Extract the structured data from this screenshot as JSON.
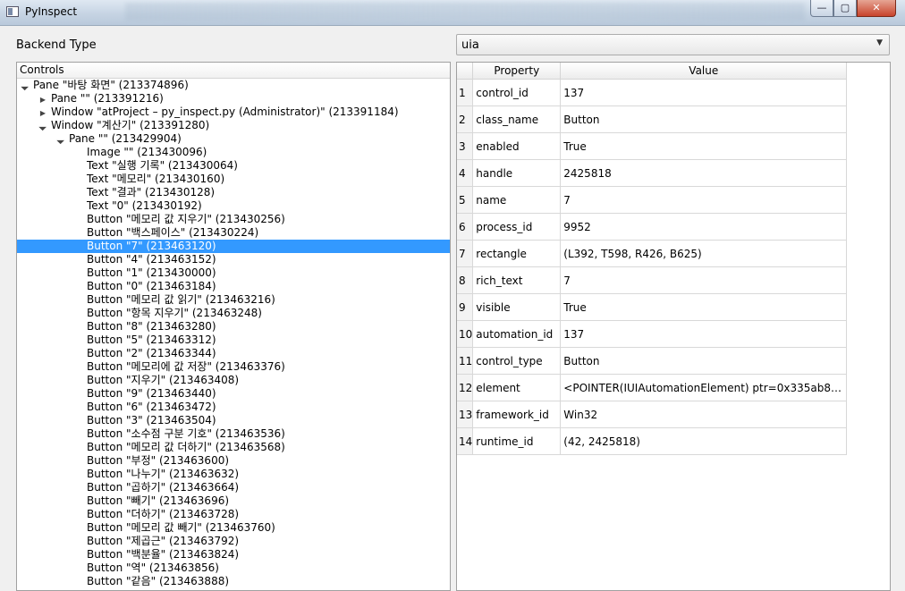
{
  "window": {
    "title": "PyInspect",
    "minimize": "—",
    "maximize": "▢",
    "close": "✕"
  },
  "backend": {
    "label": "Backend Type",
    "value": "uia"
  },
  "tree": {
    "header": "Controls",
    "rows": [
      {
        "level": 0,
        "arrow": "down",
        "text": "Pane \"바탕 화면\" (213374896)"
      },
      {
        "level": 1,
        "arrow": "right",
        "text": "Pane \"\" (213391216)"
      },
      {
        "level": 1,
        "arrow": "right",
        "text": "Window \"atProject – py_inspect.py (Administrator)\" (213391184)"
      },
      {
        "level": 1,
        "arrow": "down",
        "text": "Window \"계산기\" (213391280)"
      },
      {
        "level": 2,
        "arrow": "down",
        "text": "Pane \"\" (213429904)"
      },
      {
        "level": 3,
        "arrow": "none",
        "text": "Image \"\" (213430096)"
      },
      {
        "level": 3,
        "arrow": "none",
        "text": "Text \"실행 기록\" (213430064)"
      },
      {
        "level": 3,
        "arrow": "none",
        "text": "Text \"메모리\" (213430160)"
      },
      {
        "level": 3,
        "arrow": "none",
        "text": "Text \"결과\" (213430128)"
      },
      {
        "level": 3,
        "arrow": "none",
        "text": "Text \"0\" (213430192)"
      },
      {
        "level": 3,
        "arrow": "none",
        "text": "Button \"메모리 값 지우기\" (213430256)"
      },
      {
        "level": 3,
        "arrow": "none",
        "text": "Button \"백스페이스\" (213430224)"
      },
      {
        "level": 3,
        "arrow": "none",
        "text": "Button \"7\" (213463120)",
        "selected": true
      },
      {
        "level": 3,
        "arrow": "none",
        "text": "Button \"4\" (213463152)"
      },
      {
        "level": 3,
        "arrow": "none",
        "text": "Button \"1\" (213430000)"
      },
      {
        "level": 3,
        "arrow": "none",
        "text": "Button \"0\" (213463184)"
      },
      {
        "level": 3,
        "arrow": "none",
        "text": "Button \"메모리 값 읽기\" (213463216)"
      },
      {
        "level": 3,
        "arrow": "none",
        "text": "Button \"항목 지우기\" (213463248)"
      },
      {
        "level": 3,
        "arrow": "none",
        "text": "Button \"8\" (213463280)"
      },
      {
        "level": 3,
        "arrow": "none",
        "text": "Button \"5\" (213463312)"
      },
      {
        "level": 3,
        "arrow": "none",
        "text": "Button \"2\" (213463344)"
      },
      {
        "level": 3,
        "arrow": "none",
        "text": "Button \"메모리에 값 저장\" (213463376)"
      },
      {
        "level": 3,
        "arrow": "none",
        "text": "Button \"지우기\" (213463408)"
      },
      {
        "level": 3,
        "arrow": "none",
        "text": "Button \"9\" (213463440)"
      },
      {
        "level": 3,
        "arrow": "none",
        "text": "Button \"6\" (213463472)"
      },
      {
        "level": 3,
        "arrow": "none",
        "text": "Button \"3\" (213463504)"
      },
      {
        "level": 3,
        "arrow": "none",
        "text": "Button \"소수점 구분 기호\" (213463536)"
      },
      {
        "level": 3,
        "arrow": "none",
        "text": "Button \"메모리 값 더하기\" (213463568)"
      },
      {
        "level": 3,
        "arrow": "none",
        "text": "Button \"부정\" (213463600)"
      },
      {
        "level": 3,
        "arrow": "none",
        "text": "Button \"나누기\" (213463632)"
      },
      {
        "level": 3,
        "arrow": "none",
        "text": "Button \"곱하기\" (213463664)"
      },
      {
        "level": 3,
        "arrow": "none",
        "text": "Button \"빼기\" (213463696)"
      },
      {
        "level": 3,
        "arrow": "none",
        "text": "Button \"더하기\" (213463728)"
      },
      {
        "level": 3,
        "arrow": "none",
        "text": "Button \"메모리 값 빼기\" (213463760)"
      },
      {
        "level": 3,
        "arrow": "none",
        "text": "Button \"제곱근\" (213463792)"
      },
      {
        "level": 3,
        "arrow": "none",
        "text": "Button \"백분율\" (213463824)"
      },
      {
        "level": 3,
        "arrow": "none",
        "text": "Button \"역\" (213463856)"
      },
      {
        "level": 3,
        "arrow": "none",
        "text": "Button \"같음\" (213463888)"
      }
    ]
  },
  "properties": {
    "columns": [
      "Property",
      "Value"
    ],
    "rows": [
      {
        "num": "1",
        "name": "control_id",
        "value": "137"
      },
      {
        "num": "2",
        "name": "class_name",
        "value": "Button"
      },
      {
        "num": "3",
        "name": "enabled",
        "value": "True"
      },
      {
        "num": "4",
        "name": "handle",
        "value": "2425818"
      },
      {
        "num": "5",
        "name": "name",
        "value": "7"
      },
      {
        "num": "6",
        "name": "process_id",
        "value": "9952"
      },
      {
        "num": "7",
        "name": "rectangle",
        "value": "(L392, T598, R426, B625)"
      },
      {
        "num": "8",
        "name": "rich_text",
        "value": "7"
      },
      {
        "num": "9",
        "name": "visible",
        "value": "True"
      },
      {
        "num": "10",
        "name": "automation_id",
        "value": "137"
      },
      {
        "num": "11",
        "name": "control_type",
        "value": "Button"
      },
      {
        "num": "12",
        "name": "element",
        "value": "<POINTER(IUIAutomationElement) ptr=0x335ab80 at ..."
      },
      {
        "num": "13",
        "name": "framework_id",
        "value": "Win32"
      },
      {
        "num": "14",
        "name": "runtime_id",
        "value": "(42, 2425818)"
      }
    ]
  },
  "colors": {
    "selection": "#3399ff",
    "selection_text": "#ffffff"
  }
}
